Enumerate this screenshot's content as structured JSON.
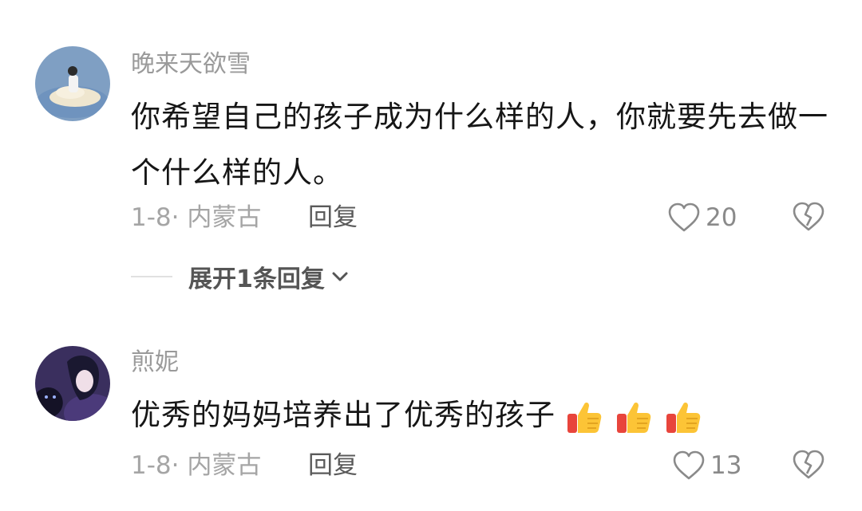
{
  "comments": [
    {
      "username": "晚来天欲雪",
      "text": "你希望自己的孩子成为什么样的人，你就要先去做一个什么样的人。",
      "date": "1-8· 内蒙古",
      "reply_label": "回复",
      "like_count": "20",
      "expand_label": "展开1条回复"
    },
    {
      "username": "煎妮",
      "text": "优秀的妈妈培养出了优秀的孩子",
      "date": "1-8· 内蒙古",
      "reply_label": "回复",
      "like_count": "13",
      "emojis": [
        "thumbs-up",
        "thumbs-up",
        "thumbs-up"
      ]
    }
  ],
  "icons": {
    "like": "heart-outline-icon",
    "dislike": "broken-heart-icon",
    "expand": "chevron-down-icon"
  },
  "colors": {
    "username": "#9a9a9a",
    "content": "#161616",
    "meta": "#a5a5a5",
    "reply": "#5a5a5a"
  }
}
